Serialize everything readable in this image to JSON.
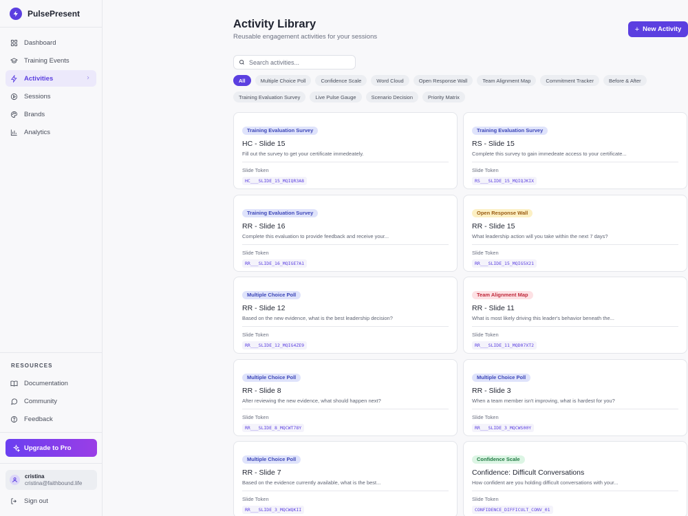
{
  "brand": {
    "name": "PulsePresent"
  },
  "nav": [
    {
      "label": "Dashboard",
      "icon": "grid-icon"
    },
    {
      "label": "Training Events",
      "icon": "graduation-cap-icon"
    },
    {
      "label": "Activities",
      "icon": "lightning-icon",
      "active": true
    },
    {
      "label": "Sessions",
      "icon": "play-circle-icon"
    },
    {
      "label": "Brands",
      "icon": "palette-icon"
    },
    {
      "label": "Analytics",
      "icon": "bar-chart-icon"
    }
  ],
  "resources": {
    "title": "RESOURCES",
    "items": [
      {
        "label": "Documentation",
        "icon": "book-icon"
      },
      {
        "label": "Community",
        "icon": "chat-bubble-icon"
      },
      {
        "label": "Feedback",
        "icon": "help-circle-icon"
      }
    ]
  },
  "upgrade": {
    "label": "Upgrade to Pro"
  },
  "user": {
    "name": "cristina",
    "email": "cristina@faithbound.life",
    "signout": "Sign out"
  },
  "header": {
    "title": "Activity Library",
    "subtitle": "Reusable engagement activities for your sessions",
    "new_button": "New Activity"
  },
  "search": {
    "placeholder": "Search activities...",
    "value": ""
  },
  "filters": [
    "All",
    "Multiple Choice Poll",
    "Confidence Scale",
    "Word Cloud",
    "Open Response Wall",
    "Team Alignment Map",
    "Commitment Tracker",
    "Before & After",
    "Training Evaluation Survey",
    "Live Pulse Gauge",
    "Scenario Decision",
    "Priority Matrix"
  ],
  "active_filter": "All",
  "token_label": "Slide Token",
  "cards": [
    {
      "type": "Training Evaluation Survey",
      "color": "#3d47b8",
      "title": "HC - Slide 15",
      "desc": "Fill out the survey to get your certificate immedeately.",
      "token": "HC___SLIDE_15_MQIQR3A8"
    },
    {
      "type": "Training Evaluation Survey",
      "color": "#3d47b8",
      "title": "RS - Slide 15",
      "desc": "Complete this survey to gain immedeate access to your certificate...",
      "token": "RS___SLIDE_15_MQIQJKIX"
    },
    {
      "type": "Training Evaluation Survey",
      "color": "#3d47b8",
      "title": "RR - Slide 16",
      "desc": "Complete this evaluation to provide feedback and receive your...",
      "token": "RR___SLIDE_16_MQIGE7A1"
    },
    {
      "type": "Open Response Wall",
      "color": "#9a5b12",
      "title": "RR - Slide 15",
      "desc": "What leadership action will you take within the next 7 days?",
      "token": "RR___SLIDE_15_MQIG5X21"
    },
    {
      "type": "Multiple Choice Poll",
      "color": "#3d47b8",
      "title": "RR - Slide 12",
      "desc": "Based on the new evidence, what is the best leadership decision?",
      "token": "RR___SLIDE_12_MQIG4ZE9"
    },
    {
      "type": "Team Alignment Map",
      "color": "#c02a3c",
      "title": "RR - Slide 11",
      "desc": "What is most likely driving this leader's behavior beneath the...",
      "token": "RR___SLIDE_11_MQD07XT2"
    },
    {
      "type": "Multiple Choice Poll",
      "color": "#3d47b8",
      "title": "RR - Slide 8",
      "desc": "After reviewing the new evidence, what should happen next?",
      "token": "RR___SLIDE_8_MQCWT78Y"
    },
    {
      "type": "Multiple Choice Poll",
      "color": "#3d47b8",
      "title": "RR - Slide 3",
      "desc": "When a team member isn't improving, what is hardest for you?",
      "token": "RR___SLIDE_3_MQCWS00Y"
    },
    {
      "type": "Multiple Choice Poll",
      "color": "#3d47b8",
      "title": "RR - Slide 7",
      "desc": "Based on the evidence currently available, what is the best...",
      "token": "RR___SLIDE_3_MQCWQKII"
    },
    {
      "type": "Confidence Scale",
      "color": "#1f7a42",
      "title": "Confidence: Difficult Conversations",
      "desc": "How confident are you holding difficult conversations with your...",
      "token": "CONFIDENCE_DIFFICULT_CONV_01"
    }
  ]
}
